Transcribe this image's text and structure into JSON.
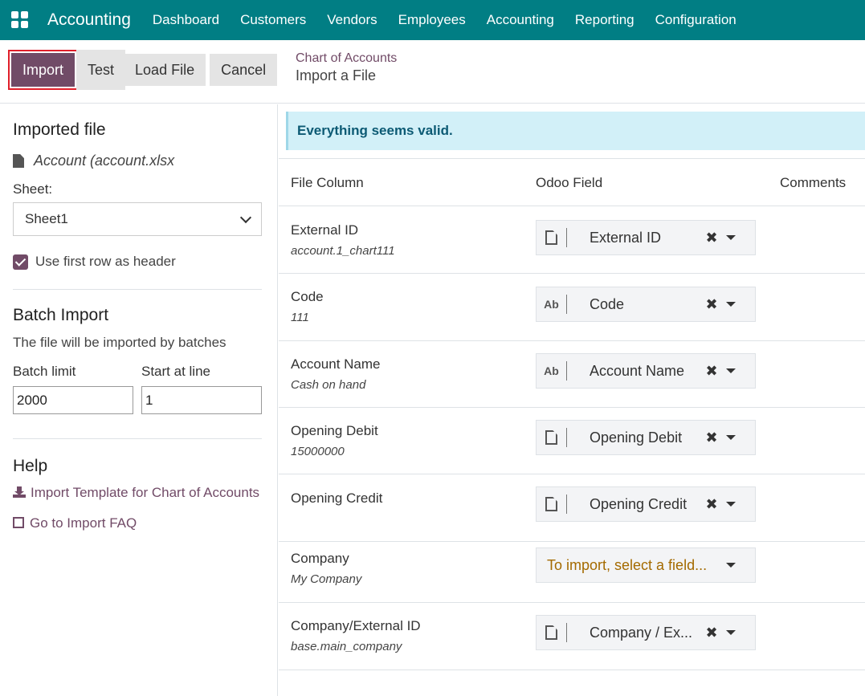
{
  "navbar": {
    "brand": "Accounting",
    "items": [
      "Dashboard",
      "Customers",
      "Vendors",
      "Employees",
      "Accounting",
      "Reporting",
      "Configuration"
    ]
  },
  "control": {
    "import_label": "Import",
    "test_label": "Test",
    "load_label": "Load File",
    "cancel_label": "Cancel",
    "breadcrumb_link": "Chart of Accounts",
    "breadcrumb_title": "Import a File"
  },
  "sidebar": {
    "imported_heading": "Imported file",
    "file_name": "Account (account.xlsx",
    "sheet_label": "Sheet:",
    "sheet_value": "Sheet1",
    "header_checkbox_label": "Use first row as header",
    "batch_heading": "Batch Import",
    "batch_desc": "The file will be imported by batches",
    "batch_limit_label": "Batch limit",
    "batch_limit_value": "2000",
    "start_line_label": "Start at line",
    "start_line_value": "1",
    "help_heading": "Help",
    "template_link": "Import Template for Chart of Accounts",
    "faq_link": "Go to Import FAQ"
  },
  "main": {
    "alert": "Everything seems valid.",
    "columns": [
      "File Column",
      "Odoo Field",
      "Comments"
    ],
    "rows": [
      {
        "name": "External ID",
        "sample": "account.1_chart111",
        "icon": "doc-icon",
        "field": "External ID"
      },
      {
        "name": "Code",
        "sample": "111",
        "icon": "Ab",
        "field": "Code"
      },
      {
        "name": "Account Name",
        "sample": "Cash on hand",
        "icon": "Ab",
        "field": "Account Name"
      },
      {
        "name": "Opening Debit",
        "sample": "15000000",
        "icon": "doc-icon",
        "field": "Opening Debit"
      },
      {
        "name": "Opening Credit",
        "sample": "",
        "icon": "doc-icon",
        "field": "Opening Credit"
      },
      {
        "name": "Company",
        "sample": "My Company",
        "icon": "",
        "field": "To import, select a field..."
      },
      {
        "name": "Company/External ID",
        "sample": "base.main_company",
        "icon": "doc-icon",
        "field": "Company / Ex..."
      }
    ]
  }
}
